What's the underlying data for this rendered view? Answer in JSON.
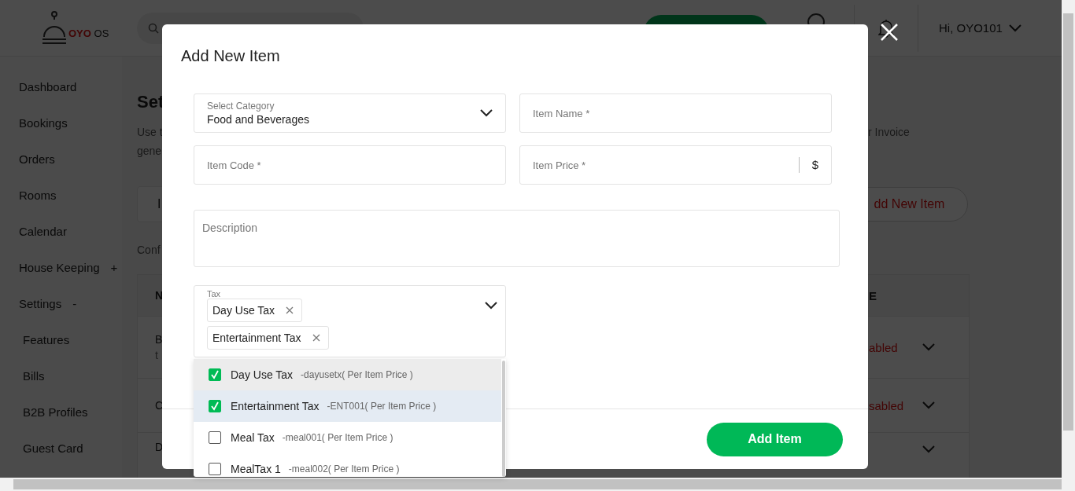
{
  "header": {
    "logo": {
      "brand": "OYO",
      "suffix": "OS"
    },
    "user": "Hi, OYO101"
  },
  "sidebar": {
    "items": [
      {
        "label": "Dashboard"
      },
      {
        "label": "Bookings"
      },
      {
        "label": "Orders"
      },
      {
        "label": "Rooms"
      },
      {
        "label": "Calendar"
      },
      {
        "label": "House Keeping",
        "toggle": "+"
      },
      {
        "label": "Settings",
        "toggle": "-",
        "children": [
          {
            "label": "Features"
          },
          {
            "label": "Bills"
          },
          {
            "label": "B2B Profiles"
          },
          {
            "label": "Guest Card"
          }
        ]
      }
    ]
  },
  "page": {
    "title": "Set",
    "description_lines": [
      {
        "left": "Use t",
        "right": "r Invoice"
      },
      {
        "left": "gene"
      }
    ],
    "tab": "I",
    "add_button": "dd New Item",
    "note": "Conf",
    "table": {
      "header": {
        "left": "N",
        "right": "E"
      },
      "rows": [
        {
          "col_1": [
            "B",
            "t"
          ],
          "status": "abled"
        },
        {
          "col_1": [
            "C"
          ],
          "status": "sabled"
        },
        {
          "col_1": [
            "D"
          ]
        }
      ]
    }
  },
  "modal": {
    "title": "Add New Item",
    "fields": [
      {
        "kind": "select",
        "label": "Select Category",
        "value": "Food and Beverages"
      },
      {
        "kind": "input",
        "placeholder": "Item Name *"
      },
      {
        "kind": "input",
        "placeholder": "Item Code *"
      },
      {
        "kind": "price",
        "placeholder": "Item Price *",
        "unit": "$"
      }
    ],
    "description": {
      "placeholder": "Description"
    },
    "tax": {
      "label": "Tax",
      "chips": [
        "Day Use Tax",
        "Entertainment Tax"
      ],
      "options": [
        {
          "name": "Day Use Tax",
          "code": "-dayusetx( Per Item Price )",
          "checked": true,
          "active": true,
          "hovered": false
        },
        {
          "name": "Entertainment Tax",
          "code": "-ENT001( Per Item Price )",
          "checked": true,
          "active": false,
          "hovered": true
        },
        {
          "name": "Meal Tax",
          "code": "-meal001( Per Item Price )",
          "checked": false,
          "active": false,
          "hovered": false
        },
        {
          "name": "MealTax 1",
          "code": "-meal002( Per Item Price )",
          "checked": false,
          "active": false,
          "hovered": false
        }
      ]
    },
    "submit": "Add Item"
  }
}
